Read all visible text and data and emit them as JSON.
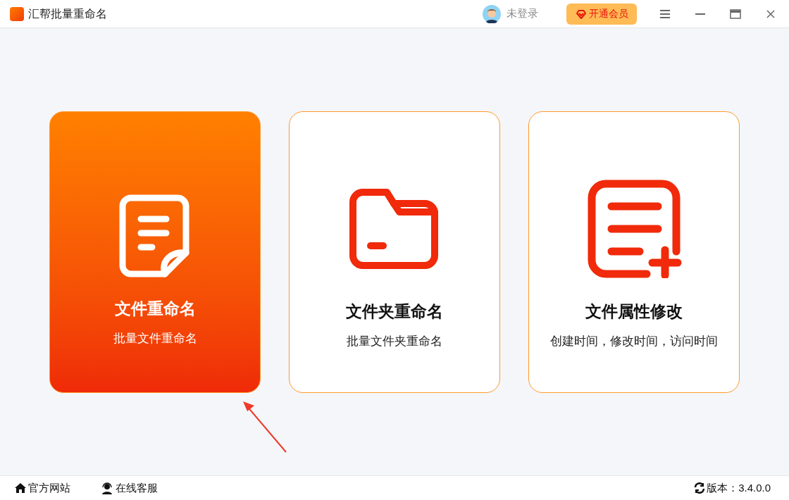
{
  "window": {
    "title": "汇帮批量重命名"
  },
  "user": {
    "label": "未登录"
  },
  "vip_button": {
    "label": "开通会员"
  },
  "cards": [
    {
      "kind": "file",
      "title": "文件重命名",
      "subtitle": "批量文件重命名",
      "selected": true
    },
    {
      "kind": "folder",
      "title": "文件夹重命名",
      "subtitle": "批量文件夹重命名",
      "selected": false
    },
    {
      "kind": "attributes",
      "title": "文件属性修改",
      "subtitle": "创建时间，修改时间，访问时间",
      "selected": false
    }
  ],
  "status_bar": {
    "links": [
      {
        "kind": "home",
        "label": "官方网站"
      },
      {
        "kind": "support",
        "label": "在线客服"
      }
    ],
    "version": "版本：3.4.0.0"
  }
}
